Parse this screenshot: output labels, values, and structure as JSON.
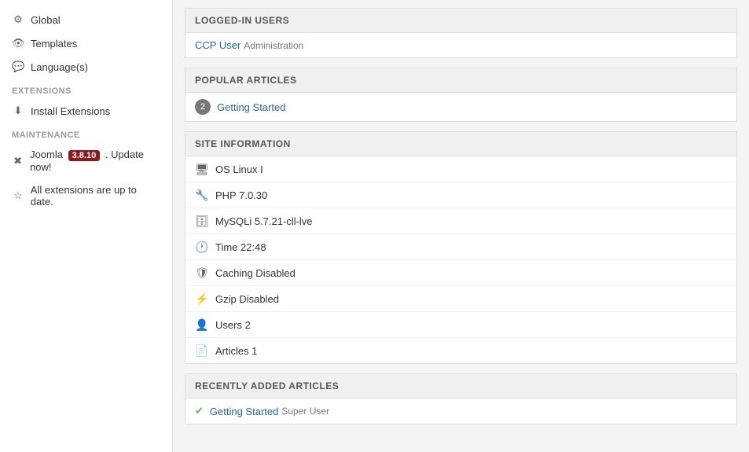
{
  "sidebar": {
    "sections": [
      {
        "items": [
          {
            "id": "global",
            "label": "Global",
            "icon": "gear"
          },
          {
            "id": "templates",
            "label": "Templates",
            "icon": "eye"
          },
          {
            "id": "languages",
            "label": "Language(s)",
            "icon": "comment"
          }
        ]
      },
      {
        "header": "EXTENSIONS",
        "items": [
          {
            "id": "install-extensions",
            "label": "Install Extensions",
            "icon": "download"
          }
        ]
      },
      {
        "header": "MAINTENANCE",
        "items": [
          {
            "id": "joomla-update",
            "label": "Joomla",
            "badge": "3.8.10",
            "suffix": ". Update now!",
            "icon": "joomla"
          },
          {
            "id": "extensions-uptodate",
            "label": "All extensions are up to date.",
            "icon": "star"
          }
        ]
      }
    ]
  },
  "panels": {
    "logged_in_users": {
      "header": "LOGGED-IN USERS",
      "users": [
        {
          "name": "CCP User",
          "role": "Administration"
        }
      ]
    },
    "popular_articles": {
      "header": "POPULAR ARTICLES",
      "articles": [
        {
          "number": "2",
          "title": "Getting Started"
        }
      ]
    },
    "site_information": {
      "header": "SITE INFORMATION",
      "items": [
        {
          "icon": "monitor",
          "label": "OS Linux I"
        },
        {
          "icon": "wrench",
          "label": "PHP 7.0.30"
        },
        {
          "icon": "db",
          "label": "MySQLi 5.7.21-cll-lve"
        },
        {
          "icon": "clock",
          "label": "Time 22:48"
        },
        {
          "icon": "shield",
          "label": "Caching Disabled"
        },
        {
          "icon": "bolt",
          "label": "Gzip Disabled"
        },
        {
          "icon": "user",
          "label": "Users 2"
        },
        {
          "icon": "file",
          "label": "Articles 1"
        }
      ]
    },
    "recently_added_articles": {
      "header": "RECENTLY ADDED ARTICLES",
      "articles": [
        {
          "title": "Getting Started",
          "author": "Super User"
        }
      ]
    }
  }
}
